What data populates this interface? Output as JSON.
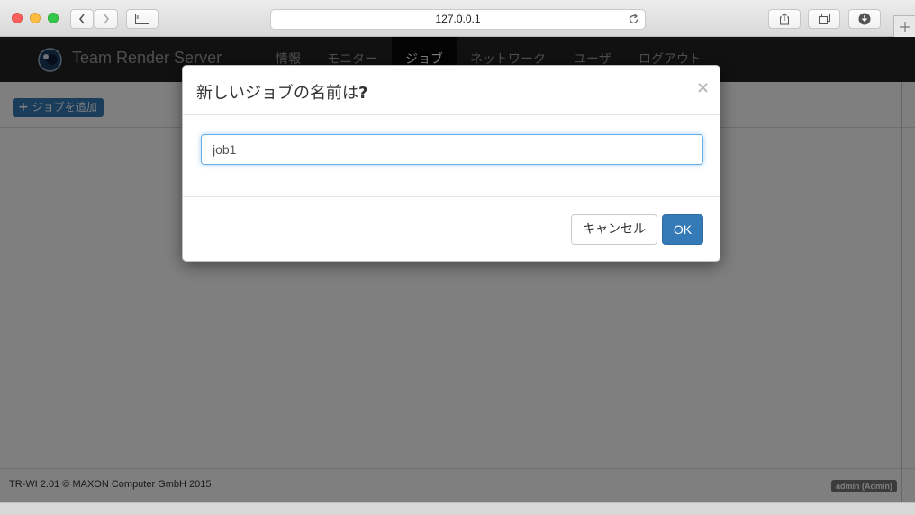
{
  "browser": {
    "address": "127.0.0.1"
  },
  "navbar": {
    "brand": "Team Render Server",
    "items": [
      {
        "label": "情報"
      },
      {
        "label": "モニター"
      },
      {
        "label": "ジョブ",
        "active": true
      },
      {
        "label": "ネットワーク"
      },
      {
        "label": "ユーザ"
      },
      {
        "label": "ログアウト"
      }
    ]
  },
  "toolbar": {
    "add_job_label": "ジョブを追加"
  },
  "footer": {
    "copyright": "TR-WI 2.01 © MAXON Computer GmbH 2015",
    "user_badge": "admin (Admin)"
  },
  "modal": {
    "title_text": "新しいジョブの名前は",
    "title_mark": "?",
    "close_glyph": "×",
    "input_value": "job1",
    "cancel_label": "キャンセル",
    "ok_label": "OK"
  },
  "colors": {
    "navbar_bg": "#222222",
    "primary": "#337ab7",
    "focus_border": "#66afe9"
  }
}
